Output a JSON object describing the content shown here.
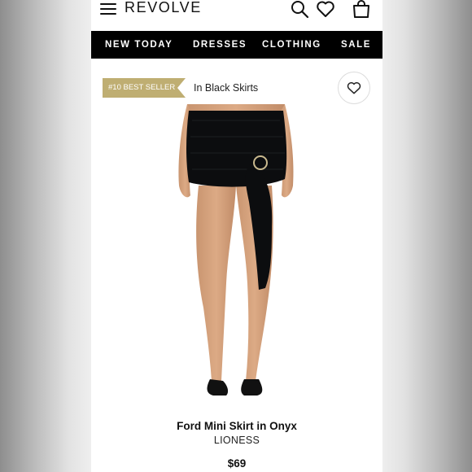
{
  "header": {
    "logo": "REVOLVE",
    "icons": [
      "menu-icon",
      "search-icon",
      "heart-icon",
      "shopping-bag-icon"
    ]
  },
  "nav": {
    "items": [
      {
        "label": "NEW TODAY"
      },
      {
        "label": "DRESSES"
      },
      {
        "label": "CLOTHING"
      },
      {
        "label": "SALE"
      }
    ]
  },
  "product": {
    "badge": "#10 BEST SELLER",
    "badge_color": "#bfae72",
    "category": "In Black Skirts",
    "name": "Ford Mini Skirt in Onyx",
    "brand": "LIONESS",
    "price": "$69"
  }
}
